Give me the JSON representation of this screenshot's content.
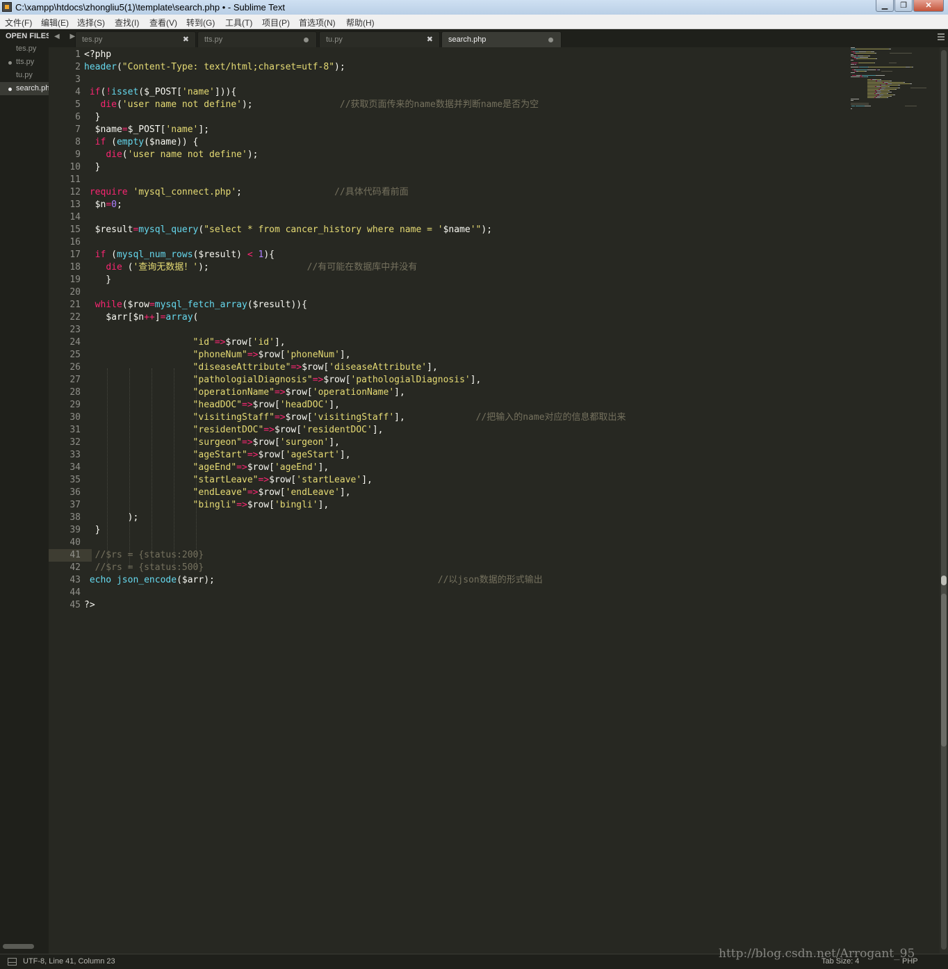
{
  "window": {
    "title": "C:\\xampp\\htdocs\\zhongliu5(1)\\template\\search.php • - Sublime Text",
    "minimize": "▁",
    "maximize": "❐",
    "close": "✕"
  },
  "menu": [
    "文件(F)",
    "编辑(E)",
    "选择(S)",
    "查找(I)",
    "查看(V)",
    "转到(G)",
    "工具(T)",
    "项目(P)",
    "首选项(N)",
    "帮助(H)"
  ],
  "sidebar": {
    "header": "OPEN FILES",
    "items": [
      {
        "label": "tes.py",
        "modified": false,
        "active": false
      },
      {
        "label": "tts.py",
        "modified": true,
        "active": false
      },
      {
        "label": "tu.py",
        "modified": false,
        "active": false
      },
      {
        "label": "search.php",
        "modified": true,
        "active": true
      }
    ]
  },
  "tabs": [
    {
      "label": "tes.py",
      "state": "close"
    },
    {
      "label": "tts.py",
      "state": "modified"
    },
    {
      "label": "tu.py",
      "state": "close"
    },
    {
      "label": "search.php",
      "state": "modified",
      "active": true
    }
  ],
  "tab_close_glyph": "✖",
  "tab_arrows": "◀ ▶",
  "editor": {
    "current_line": 41,
    "colors": {
      "plain": "#f8f8f2",
      "keyword": "#f92672",
      "function": "#66d9ef",
      "string": "#e6db74",
      "number": "#ae81ff",
      "comment": "#75715e"
    },
    "lines": [
      [
        [
          "p",
          "<?php"
        ]
      ],
      [
        [
          "f",
          "header"
        ],
        [
          "p",
          "("
        ],
        [
          "s",
          "\"Content-Type: text/html;charset=utf-8\""
        ],
        [
          "p",
          ");"
        ]
      ],
      [],
      [
        [
          "p",
          " "
        ],
        [
          "k",
          "if"
        ],
        [
          "p",
          "("
        ],
        [
          "k",
          "!"
        ],
        [
          "f",
          "isset"
        ],
        [
          "p",
          "($_POST["
        ],
        [
          "s",
          "'name'"
        ],
        [
          "p",
          "])){"
        ]
      ],
      [
        [
          "p",
          "   "
        ],
        [
          "k",
          "die"
        ],
        [
          "p",
          "("
        ],
        [
          "s",
          "'user name not define'"
        ],
        [
          "p",
          ");"
        ],
        [
          "p",
          "                "
        ],
        [
          "c",
          "//获取页面传来的name数据并判断name是否为空"
        ]
      ],
      [
        [
          "p",
          "  }"
        ]
      ],
      [
        [
          "p",
          "  $name"
        ],
        [
          "k",
          "="
        ],
        [
          "p",
          "$_POST["
        ],
        [
          "s",
          "'name'"
        ],
        [
          "p",
          "];"
        ]
      ],
      [
        [
          "p",
          "  "
        ],
        [
          "k",
          "if"
        ],
        [
          "p",
          " ("
        ],
        [
          "f",
          "empty"
        ],
        [
          "p",
          "($name)) {"
        ]
      ],
      [
        [
          "p",
          "    "
        ],
        [
          "k",
          "die"
        ],
        [
          "p",
          "("
        ],
        [
          "s",
          "'user name not define'"
        ],
        [
          "p",
          ");"
        ]
      ],
      [
        [
          "p",
          "  }"
        ]
      ],
      [],
      [
        [
          "p",
          " "
        ],
        [
          "k",
          "require"
        ],
        [
          "p",
          " "
        ],
        [
          "s",
          "'mysql_connect.php'"
        ],
        [
          "p",
          ";"
        ],
        [
          "p",
          "                 "
        ],
        [
          "c",
          "//具体代码看前面"
        ]
      ],
      [
        [
          "p",
          "  $n"
        ],
        [
          "k",
          "="
        ],
        [
          "n",
          "0"
        ],
        [
          "p",
          ";"
        ]
      ],
      [],
      [
        [
          "p",
          "  $result"
        ],
        [
          "k",
          "="
        ],
        [
          "f",
          "mysql_query"
        ],
        [
          "p",
          "("
        ],
        [
          "s",
          "\"select * from cancer_history where name = '"
        ],
        [
          "p",
          "$name"
        ],
        [
          "s",
          "'\""
        ],
        [
          "p",
          ");"
        ]
      ],
      [],
      [
        [
          "p",
          "  "
        ],
        [
          "k",
          "if"
        ],
        [
          "p",
          " ("
        ],
        [
          "f",
          "mysql_num_rows"
        ],
        [
          "p",
          "($result) "
        ],
        [
          "k",
          "<"
        ],
        [
          "p",
          " "
        ],
        [
          "n",
          "1"
        ],
        [
          "p",
          "){"
        ]
      ],
      [
        [
          "p",
          "    "
        ],
        [
          "k",
          "die"
        ],
        [
          "p",
          " ("
        ],
        [
          "s",
          "'查询无数据！'"
        ],
        [
          "p",
          ");"
        ],
        [
          "p",
          "                  "
        ],
        [
          "c",
          "//有可能在数据库中并没有"
        ]
      ],
      [
        [
          "p",
          "    }"
        ]
      ],
      [],
      [
        [
          "p",
          "  "
        ],
        [
          "k",
          "while"
        ],
        [
          "p",
          "($row"
        ],
        [
          "k",
          "="
        ],
        [
          "f",
          "mysql_fetch_array"
        ],
        [
          "p",
          "($result)){"
        ]
      ],
      [
        [
          "p",
          "    $arr[$n"
        ],
        [
          "k",
          "++"
        ],
        [
          "p",
          "]"
        ],
        [
          "k",
          "="
        ],
        [
          "f",
          "array"
        ],
        [
          "p",
          "("
        ]
      ],
      [],
      [
        [
          "p",
          "                    "
        ],
        [
          "s",
          "\"id\""
        ],
        [
          "k",
          "=>"
        ],
        [
          "p",
          "$row["
        ],
        [
          "s",
          "'id'"
        ],
        [
          "p",
          "],"
        ]
      ],
      [
        [
          "p",
          "                    "
        ],
        [
          "s",
          "\"phoneNum\""
        ],
        [
          "k",
          "=>"
        ],
        [
          "p",
          "$row["
        ],
        [
          "s",
          "'phoneNum'"
        ],
        [
          "p",
          "],"
        ]
      ],
      [
        [
          "p",
          "                    "
        ],
        [
          "s",
          "\"diseaseAttribute\""
        ],
        [
          "k",
          "=>"
        ],
        [
          "p",
          "$row["
        ],
        [
          "s",
          "'diseaseAttribute'"
        ],
        [
          "p",
          "],"
        ]
      ],
      [
        [
          "p",
          "                    "
        ],
        [
          "s",
          "\"pathologialDiagnosis\""
        ],
        [
          "k",
          "=>"
        ],
        [
          "p",
          "$row["
        ],
        [
          "s",
          "'pathologialDiagnosis'"
        ],
        [
          "p",
          "],"
        ]
      ],
      [
        [
          "p",
          "                    "
        ],
        [
          "s",
          "\"operationName\""
        ],
        [
          "k",
          "=>"
        ],
        [
          "p",
          "$row["
        ],
        [
          "s",
          "'operationName'"
        ],
        [
          "p",
          "],"
        ]
      ],
      [
        [
          "p",
          "                    "
        ],
        [
          "s",
          "\"headDOC\""
        ],
        [
          "k",
          "=>"
        ],
        [
          "p",
          "$row["
        ],
        [
          "s",
          "'headDOC'"
        ],
        [
          "p",
          "],"
        ]
      ],
      [
        [
          "p",
          "                    "
        ],
        [
          "s",
          "\"visitingStaff\""
        ],
        [
          "k",
          "=>"
        ],
        [
          "p",
          "$row["
        ],
        [
          "s",
          "'visitingStaff'"
        ],
        [
          "p",
          "],"
        ],
        [
          "p",
          "             "
        ],
        [
          "c",
          "//把输入的name对应的信息都取出来"
        ]
      ],
      [
        [
          "p",
          "                    "
        ],
        [
          "s",
          "\"residentDOC\""
        ],
        [
          "k",
          "=>"
        ],
        [
          "p",
          "$row["
        ],
        [
          "s",
          "'residentDOC'"
        ],
        [
          "p",
          "],"
        ]
      ],
      [
        [
          "p",
          "                    "
        ],
        [
          "s",
          "\"surgeon\""
        ],
        [
          "k",
          "=>"
        ],
        [
          "p",
          "$row["
        ],
        [
          "s",
          "'surgeon'"
        ],
        [
          "p",
          "],"
        ]
      ],
      [
        [
          "p",
          "                    "
        ],
        [
          "s",
          "\"ageStart\""
        ],
        [
          "k",
          "=>"
        ],
        [
          "p",
          "$row["
        ],
        [
          "s",
          "'ageStart'"
        ],
        [
          "p",
          "],"
        ]
      ],
      [
        [
          "p",
          "                    "
        ],
        [
          "s",
          "\"ageEnd\""
        ],
        [
          "k",
          "=>"
        ],
        [
          "p",
          "$row["
        ],
        [
          "s",
          "'ageEnd'"
        ],
        [
          "p",
          "],"
        ]
      ],
      [
        [
          "p",
          "                    "
        ],
        [
          "s",
          "\"startLeave\""
        ],
        [
          "k",
          "=>"
        ],
        [
          "p",
          "$row["
        ],
        [
          "s",
          "'startLeave'"
        ],
        [
          "p",
          "],"
        ]
      ],
      [
        [
          "p",
          "                    "
        ],
        [
          "s",
          "\"endLeave\""
        ],
        [
          "k",
          "=>"
        ],
        [
          "p",
          "$row["
        ],
        [
          "s",
          "'endLeave'"
        ],
        [
          "p",
          "],"
        ]
      ],
      [
        [
          "p",
          "                    "
        ],
        [
          "s",
          "\"bingli\""
        ],
        [
          "k",
          "=>"
        ],
        [
          "p",
          "$row["
        ],
        [
          "s",
          "'bingli'"
        ],
        [
          "p",
          "],"
        ]
      ],
      [
        [
          "p",
          "        );"
        ]
      ],
      [
        [
          "p",
          "  }"
        ]
      ],
      [],
      [
        [
          "c",
          "  //$rs = {status:200}"
        ]
      ],
      [
        [
          "c",
          "  //$rs = {status:500}"
        ]
      ],
      [
        [
          "p",
          " "
        ],
        [
          "f",
          "echo"
        ],
        [
          "p",
          " "
        ],
        [
          "f",
          "json_encode"
        ],
        [
          "p",
          "($arr);"
        ],
        [
          "p",
          "                                         "
        ],
        [
          "c",
          "//以json数据的形式输出"
        ]
      ],
      [],
      [
        [
          "p",
          "?>"
        ]
      ]
    ]
  },
  "status": {
    "left": "UTF-8, Line 41, Column 23",
    "tab_size": "Tab Size: 4",
    "syntax": "PHP"
  },
  "watermark": "http://blog.csdn.net/Arrogant_95"
}
